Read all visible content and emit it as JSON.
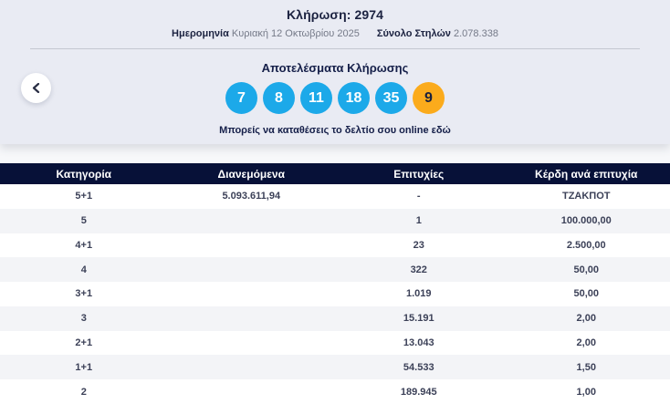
{
  "colors": {
    "panel_background": "#e9ebf3",
    "ball_blue": "#1ca9e9",
    "ball_bonus_orange": "#fbab1c",
    "table_header_navy": "#071138",
    "navy_text": "#1b2240"
  },
  "draw": {
    "title": "Κλήρωση: 2974",
    "date_label": "Ημερομηνία",
    "date_value": "Κυριακή 12 Οκτωβρίου 2025",
    "columns_label": "Σύνολο Στηλών",
    "columns_value": "2.078.338",
    "results_title": "Αποτελέσματα Κλήρωσης",
    "numbers": [
      "7",
      "8",
      "11",
      "18",
      "35"
    ],
    "bonus_number": "9",
    "cta_text": "Μπορείς να καταθέσεις το δελτίο σου online εδώ"
  },
  "table": {
    "headers": [
      "Κατηγορία",
      "Διανεμόμενα",
      "Επιτυχίες",
      "Κέρδη ανά επιτυχία"
    ],
    "rows": [
      {
        "category": "5+1",
        "distributed": "5.093.611,94",
        "winners": "-",
        "winnings": "ΤΖΑΚΠΟΤ"
      },
      {
        "category": "5",
        "distributed": "",
        "winners": "1",
        "winnings": "100.000,00"
      },
      {
        "category": "4+1",
        "distributed": "",
        "winners": "23",
        "winnings": "2.500,00"
      },
      {
        "category": "4",
        "distributed": "",
        "winners": "322",
        "winnings": "50,00"
      },
      {
        "category": "3+1",
        "distributed": "",
        "winners": "1.019",
        "winnings": "50,00"
      },
      {
        "category": "3",
        "distributed": "",
        "winners": "15.191",
        "winnings": "2,00"
      },
      {
        "category": "2+1",
        "distributed": "",
        "winners": "13.043",
        "winnings": "2,00"
      },
      {
        "category": "1+1",
        "distributed": "",
        "winners": "54.533",
        "winnings": "1,50"
      },
      {
        "category": "2",
        "distributed": "",
        "winners": "189.945",
        "winnings": "1,00"
      }
    ]
  }
}
